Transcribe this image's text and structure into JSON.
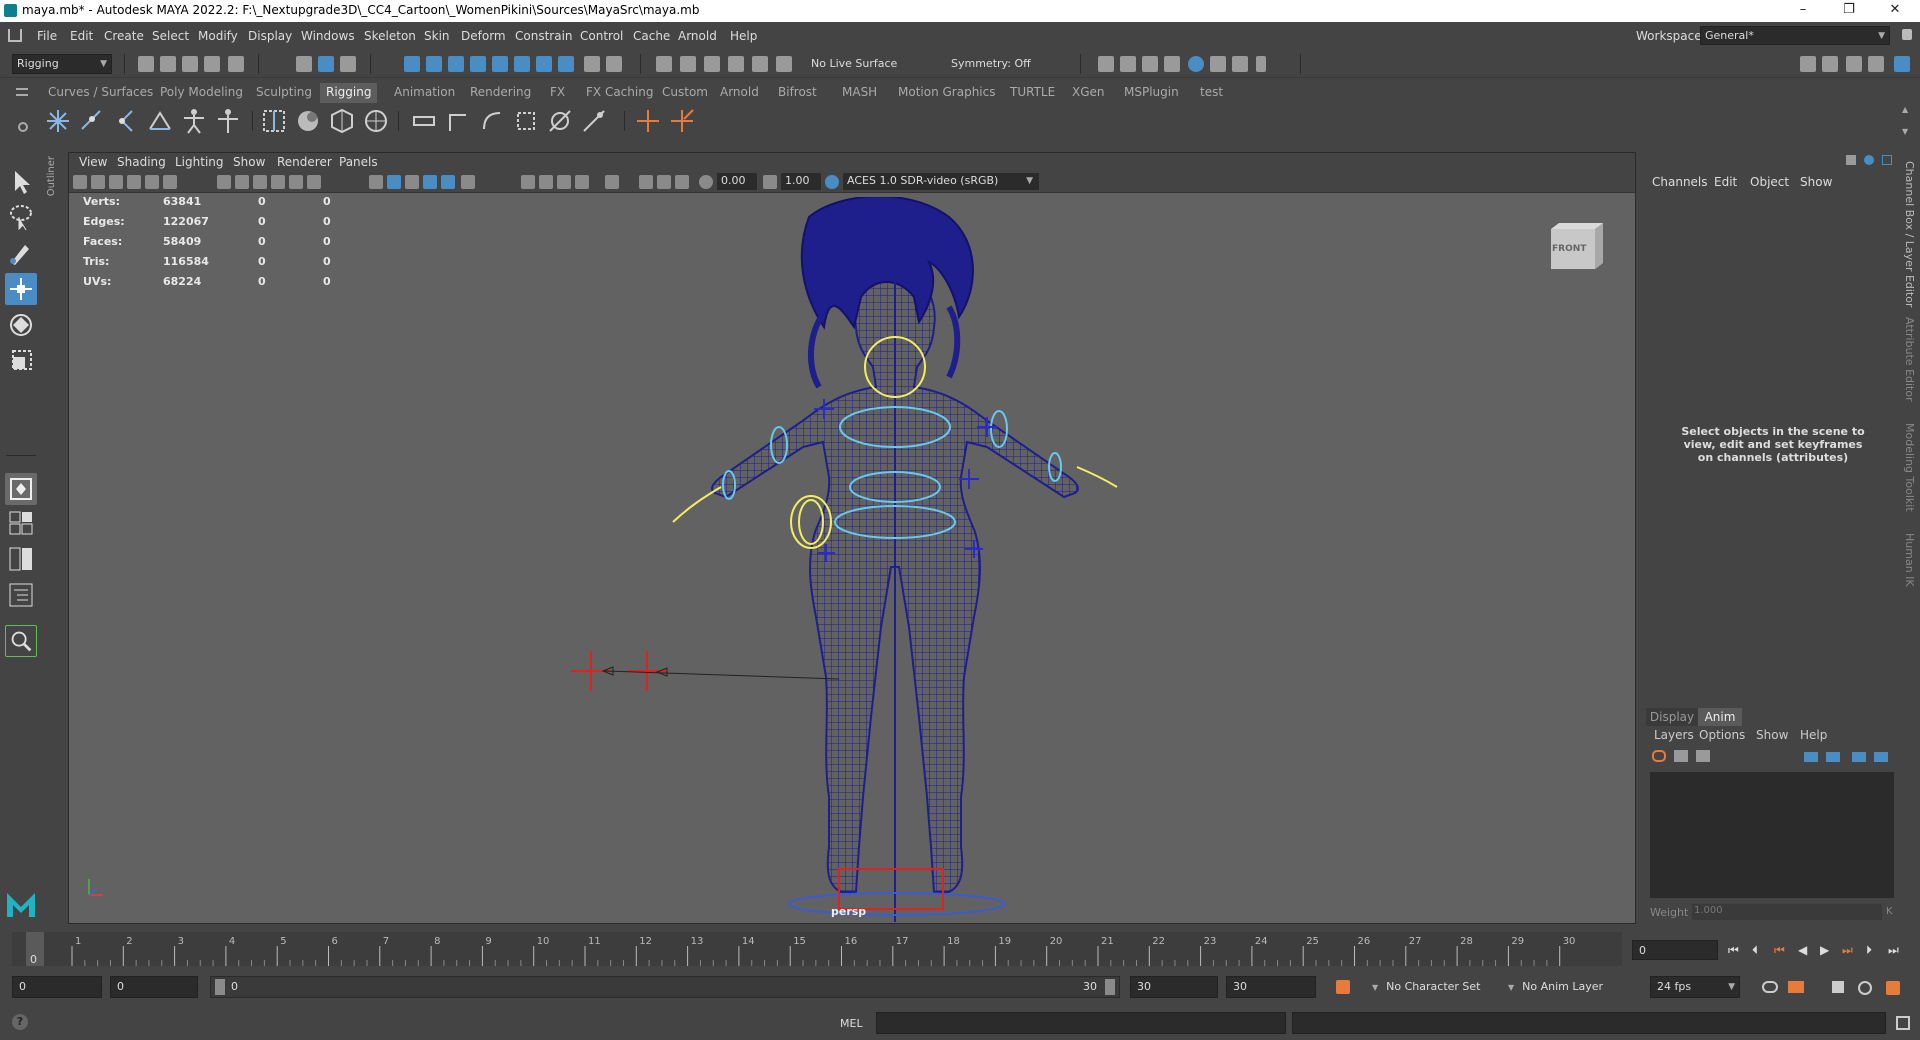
{
  "titlebar": {
    "title": "maya.mb* - Autodesk MAYA 2022.2: F:\\_Nextupgrade3D\\_CC4_Cartoon\\_WomenPikini\\Sources\\MayaSrc\\maya.mb",
    "minimize": "–",
    "maximize": "❐",
    "close": "✕"
  },
  "menubar": {
    "items": [
      "File",
      "Edit",
      "Create",
      "Select",
      "Modify",
      "Display",
      "Windows",
      "Skeleton",
      "Skin",
      "Deform",
      "Constrain",
      "Control",
      "Cache",
      "Arnold",
      "Help"
    ],
    "workspace_label": "Workspace:",
    "workspace_value": "General*"
  },
  "statusline": {
    "menuset": "Rigging",
    "live_surface": "No Live Surface",
    "symmetry": "Symmetry: Off"
  },
  "shelf": {
    "tabs": [
      "Curves / Surfaces",
      "Poly Modeling",
      "Sculpting",
      "Rigging",
      "Animation",
      "Rendering",
      "FX",
      "FX Caching",
      "Custom",
      "Arnold",
      "Bifrost",
      "MASH",
      "Motion Graphics",
      "TURTLE",
      "XGen",
      "MSPlugin",
      "test"
    ],
    "active_tab": "Rigging"
  },
  "outliner_tab": "Outliner",
  "viewport": {
    "menus": [
      "View",
      "Shading",
      "Lighting",
      "Show",
      "Renderer",
      "Panels"
    ],
    "exposure": "0.00",
    "gamma": "1.00",
    "colorspace": "ACES 1.0 SDR-video (sRGB)",
    "camera_label": "persp",
    "viewcube": "FRONT",
    "hud": [
      {
        "label": "Verts:",
        "v1": "63841",
        "v2": "0",
        "v3": "0"
      },
      {
        "label": "Edges:",
        "v1": "122067",
        "v2": "0",
        "v3": "0"
      },
      {
        "label": "Faces:",
        "v1": "58409",
        "v2": "0",
        "v3": "0"
      },
      {
        "label": "Tris:",
        "v1": "116584",
        "v2": "0",
        "v3": "0"
      },
      {
        "label": "UVs:",
        "v1": "68224",
        "v2": "0",
        "v3": "0"
      }
    ]
  },
  "channelbox": {
    "menus": [
      "Channels",
      "Edit",
      "Object",
      "Show"
    ],
    "message": "Select objects in the scene to view, edit and set keyframes on channels (attributes)",
    "side_tabs": [
      "Channel Box / Layer Editor",
      "Attribute Editor",
      "Modeling Toolkit",
      "Human IK"
    ]
  },
  "layer_editor": {
    "tabs": [
      "Display",
      "Anim"
    ],
    "active_tab": "Anim",
    "menus": [
      "Layers",
      "Options",
      "Show",
      "Help"
    ],
    "weight_label": "Weight",
    "weight_value": "1.000",
    "weight_k": "K"
  },
  "timeslider": {
    "ticks": [
      "1",
      "2",
      "3",
      "4",
      "5",
      "6",
      "7",
      "8",
      "9",
      "10",
      "11",
      "12",
      "13",
      "14",
      "15",
      "16",
      "17",
      "18",
      "19",
      "20",
      "21",
      "22",
      "23",
      "24",
      "25",
      "26",
      "27",
      "28",
      "29",
      "30"
    ],
    "start_label": "0",
    "current_frame": "0",
    "current_field": "0"
  },
  "rangebar": {
    "start": "0",
    "anim_start": "0",
    "range_start": "0",
    "range_end": "30",
    "anim_end": "30",
    "end": "30",
    "character_set": "No Character Set",
    "anim_layer": "No Anim Layer",
    "fps": "24 fps"
  },
  "cmdline": {
    "help": "?",
    "lang": "MEL"
  },
  "colors": {
    "bg": "#444444",
    "viewport": "#626262",
    "accent": "#4a8dc4",
    "wire": "#1e1e8c",
    "control": "#f2ee60"
  }
}
